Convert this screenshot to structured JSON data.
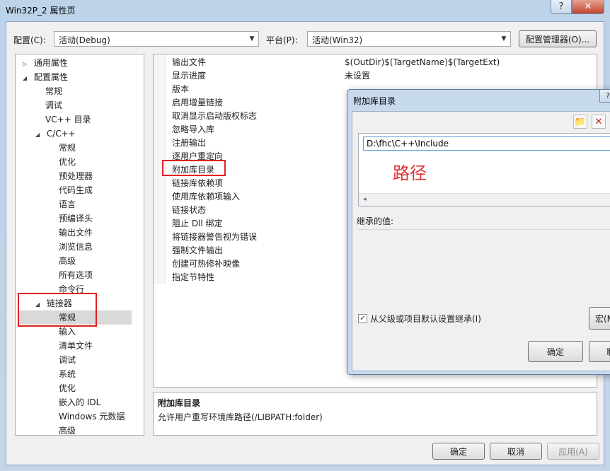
{
  "window": {
    "title": "Win32P_2 属性页",
    "help_glyph": "?",
    "close_glyph": "✕"
  },
  "config_bar": {
    "config_label": "配置(C):",
    "config_value": "活动(Debug)",
    "platform_label": "平台(P):",
    "platform_value": "活动(Win32)",
    "manager_button": "配置管理器(O)..."
  },
  "tree": {
    "items": [
      {
        "label": "通用属性",
        "toggle": "▷"
      },
      {
        "label": "配置属性",
        "toggle": "◢"
      },
      {
        "label": "常规"
      },
      {
        "label": "调试"
      },
      {
        "label": "VC++ 目录"
      },
      {
        "label": "C/C++",
        "toggle": "◢"
      },
      {
        "label": "常规"
      },
      {
        "label": "优化"
      },
      {
        "label": "预处理器"
      },
      {
        "label": "代码生成"
      },
      {
        "label": "语言"
      },
      {
        "label": "预编译头"
      },
      {
        "label": "输出文件"
      },
      {
        "label": "浏览信息"
      },
      {
        "label": "高级"
      },
      {
        "label": "所有选项"
      },
      {
        "label": "命令行"
      },
      {
        "label": "链接器",
        "toggle": "◢"
      },
      {
        "label": "常规"
      },
      {
        "label": "输入"
      },
      {
        "label": "清单文件"
      },
      {
        "label": "调试"
      },
      {
        "label": "系统"
      },
      {
        "label": "优化"
      },
      {
        "label": "嵌入的 IDL"
      },
      {
        "label": "Windows 元数据"
      },
      {
        "label": "高级"
      }
    ]
  },
  "grid": {
    "rows": [
      {
        "name": "输出文件",
        "value": "$(OutDir)$(TargetName)$(TargetExt)"
      },
      {
        "name": "显示进度",
        "value": "未设置"
      },
      {
        "name": "版本",
        "value": ""
      },
      {
        "name": "启用增量链接",
        "value": ""
      },
      {
        "name": "取消显示启动版权标志",
        "value": ""
      },
      {
        "name": "忽略导入库",
        "value": ""
      },
      {
        "name": "注册输出",
        "value": ""
      },
      {
        "name": "逐用户重定向",
        "value": ""
      },
      {
        "name": "附加库目录",
        "value": ""
      },
      {
        "name": "链接库依赖项",
        "value": ""
      },
      {
        "name": "使用库依赖项输入",
        "value": ""
      },
      {
        "name": "链接状态",
        "value": ""
      },
      {
        "name": "阻止 Dll 绑定",
        "value": ""
      },
      {
        "name": "将链接器警告视为错误",
        "value": ""
      },
      {
        "name": "强制文件输出",
        "value": ""
      },
      {
        "name": "创建可热修补映像",
        "value": ""
      },
      {
        "name": "指定节特性",
        "value": ""
      }
    ]
  },
  "description": {
    "title": "附加库目录",
    "text": "允许用户重写环境库路径(/LIBPATH:folder)"
  },
  "footer": {
    "ok": "确定",
    "cancel": "取消",
    "apply": "应用(A)"
  },
  "dialog": {
    "title": "附加库目录",
    "help_glyph": "?",
    "folder_icon_glyph": "📁",
    "delete_icon_glyph": "✕",
    "path_value": "D:\\fhc\\C++\\Include",
    "annotation": "路径",
    "scroll_glyph": "◂",
    "inherited_label": "继承的值:",
    "inherit_checkbox_label": "从父级或项目默认设置继承(I)",
    "check_glyph": "✓",
    "macro_button": "宏(M",
    "ok": "确定",
    "cancel": "取"
  }
}
